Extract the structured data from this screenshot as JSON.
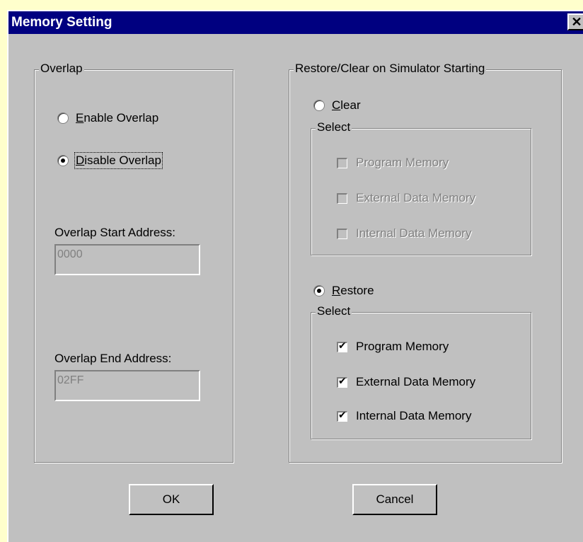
{
  "dialog": {
    "title": "Memory Setting",
    "close_label": "✕"
  },
  "overlap": {
    "legend": "Overlap",
    "enable_first": "E",
    "enable_rest": "nable Overlap",
    "disable_first": "D",
    "disable_rest": "isable Overlap",
    "selected": "disable",
    "start_label": "Overlap Start Address:",
    "start_value": "0000",
    "end_label": "Overlap End Address:",
    "end_value": "02FF"
  },
  "restore_clear": {
    "legend": "Restore/Clear on Simulator Starting",
    "clear_first": "C",
    "clear_rest": "lear",
    "restore_first": "R",
    "restore_rest": "estore",
    "selected": "restore",
    "clear_select_legend": "Select",
    "restore_select_legend": "Select",
    "clear_items": [
      "Program Memory",
      "External Data Memory",
      "Internal Data Memory"
    ],
    "restore_items": [
      "Program Memory",
      "External Data Memory",
      "Internal Data Memory"
    ]
  },
  "buttons": {
    "ok": "OK",
    "cancel": "Cancel"
  },
  "colors": {
    "title_bar": "#000080",
    "face": "#c0c0c0",
    "background": "#ffffcc"
  }
}
